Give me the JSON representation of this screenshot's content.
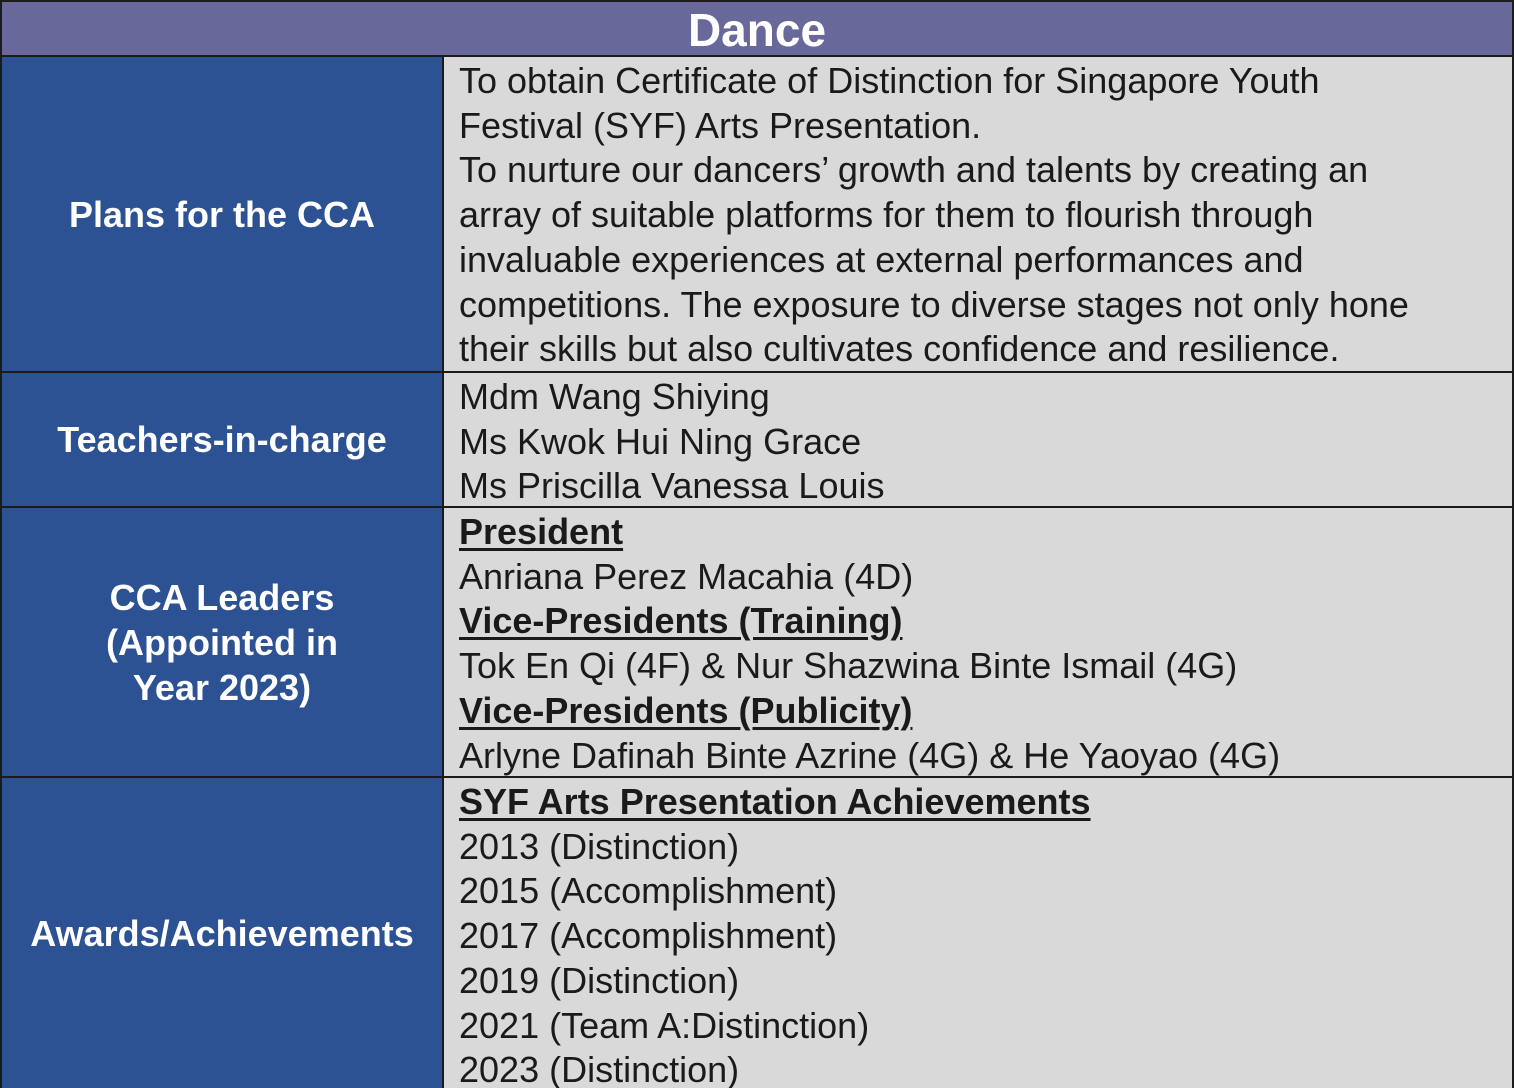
{
  "title": "Dance",
  "rows": {
    "plans": {
      "label": "Plans for the CCA",
      "lines": [
        "To obtain Certificate of Distinction for Singapore Youth",
        "Festival (SYF) Arts Presentation.",
        "To nurture our dancers’ growth and talents by creating an",
        "array of suitable platforms for them to flourish through",
        "invaluable experiences at external performances and",
        "competitions. The exposure to diverse stages not only hone",
        "their skills but also cultivates confidence and resilience."
      ]
    },
    "teachers": {
      "label": "Teachers-in-charge",
      "lines": [
        "Mdm Wang Shiying",
        "Ms Kwok Hui Ning Grace",
        "Ms Priscilla Vanessa Louis"
      ]
    },
    "leaders": {
      "label": "CCA Leaders\n(Appointed in\nYear 2023)",
      "president_heading": "President",
      "president": "Anriana Perez Macahia (4D)",
      "vp_training_heading": "Vice-Presidents (Training)",
      "vp_training": "Tok En Qi (4F) & Nur Shazwina Binte Ismail (4G)",
      "vp_publicity_heading": "Vice-Presidents (Publicity)",
      "vp_publicity": "Arlyne Dafinah Binte Azrine (4G) & He Yaoyao (4G)"
    },
    "awards": {
      "label": "Awards/Achievements",
      "heading": "SYF Arts Presentation Achievements",
      "lines": [
        "2013 (Distinction)",
        "2015 (Accomplishment)",
        "2017 (Accomplishment)",
        "2019 (Distinction)",
        "2021 (Team A:Distinction)",
        "2023 (Distinction)"
      ]
    }
  },
  "colors": {
    "title_bar": "#68689b",
    "label_cell": "#2c5293",
    "content_cell": "#d9d9d9",
    "border": "#1b1b1b"
  }
}
